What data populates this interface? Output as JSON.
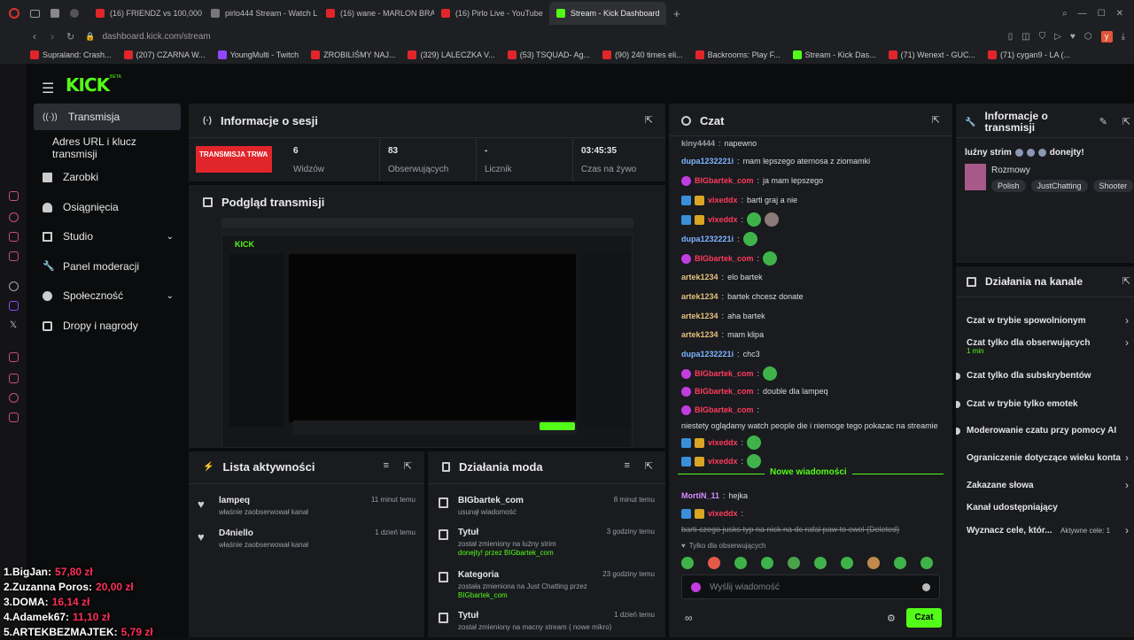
{
  "browser": {
    "tabs": [
      {
        "label": "(16) FRIENDZ vs 100,000 H",
        "icon": "youtube-favicon"
      },
      {
        "label": "pirlo444 Stream - Watch L",
        "icon": "generic-favicon"
      },
      {
        "label": "(16) wane - MARLON BRAN",
        "icon": "youtube-favicon"
      },
      {
        "label": "(16) Pirlo Live - YouTube",
        "icon": "youtube-favicon"
      },
      {
        "label": "Stream - Kick Dashboard",
        "icon": "kick-favicon",
        "active": true
      }
    ],
    "url": "dashboard.kick.com/stream",
    "bookmarks": [
      {
        "label": "Supraland: Crash...",
        "icon": "youtube-favicon"
      },
      {
        "label": "(207) CZARNA W...",
        "icon": "youtube-favicon"
      },
      {
        "label": "YoungMulti - Twitch",
        "icon": "twitch-favicon"
      },
      {
        "label": "ZROBILIŚMY NAJ...",
        "icon": "youtube-favicon"
      },
      {
        "label": "(329) LALECZKA V...",
        "icon": "youtube-favicon"
      },
      {
        "label": "(53) TSQUAD- Ag...",
        "icon": "youtube-favicon"
      },
      {
        "label": "(90) 240 times eli...",
        "icon": "youtube-favicon"
      },
      {
        "label": "Backrooms: Play F...",
        "icon": "youtube-favicon"
      },
      {
        "label": "Stream - Kick Das...",
        "icon": "kick-favicon"
      },
      {
        "label": "(71) Wenext - GUC...",
        "icon": "youtube-favicon"
      },
      {
        "label": "(71) cygan9 - LA (...",
        "icon": "youtube-favicon"
      }
    ],
    "profile_letter": "y"
  },
  "sidebar": {
    "logo": "KICK",
    "logo_sup": "BETA",
    "items": [
      {
        "label": "Transmisja",
        "icon": "broadcast-icon"
      },
      {
        "label": "Adres URL i klucz transmisji",
        "icon": ""
      },
      {
        "label": "Zarobki",
        "icon": "earnings-icon"
      },
      {
        "label": "Osiągnięcia",
        "icon": "trophy-icon"
      },
      {
        "label": "Studio",
        "icon": "studio-icon"
      },
      {
        "label": "Panel moderacji",
        "icon": "wrench-icon"
      },
      {
        "label": "Społeczność",
        "icon": "community-icon"
      },
      {
        "label": "Dropy i nagrody",
        "icon": "gift-icon"
      }
    ]
  },
  "session": {
    "title": "Informacje o sesji",
    "status": "TRANSMISJA TRWA",
    "stats": [
      {
        "value": "6",
        "label": "Widzów"
      },
      {
        "value": "83",
        "label": "Obserwujących"
      },
      {
        "value": "-",
        "label": "Licznik"
      },
      {
        "value": "03:45:35",
        "label": "Czas na żywo"
      }
    ]
  },
  "preview": {
    "title": "Podgląd transmisji"
  },
  "activity": {
    "title": "Lista aktywności",
    "items": [
      {
        "user": "lampeq",
        "desc": "właśnie zaobserwował kanał",
        "time": "11 minut temu"
      },
      {
        "user": "D4niello",
        "desc": "właśnie zaobserwował kanał",
        "time": "1 dzień temu"
      }
    ]
  },
  "modactions": {
    "title": "Działania moda",
    "items": [
      {
        "title": "BIGbartek_com",
        "line1": "usunął wiadomość",
        "line2": "",
        "time": "8 minut temu",
        "icon": "trash-icon"
      },
      {
        "title": "Tytuł",
        "line1": "został zmieniony na luźny strim",
        "line2": "donejty! przez BIGbartek_com",
        "time": "3 godziny temu",
        "icon": "user-edit-icon"
      },
      {
        "title": "Kategoria",
        "line1": "została zmieniona na Just Chatting przez",
        "line2": "BIGbartek_com",
        "time": "23 godziny temu",
        "icon": "category-icon"
      },
      {
        "title": "Tytuł",
        "line1": "został zmieniony na macny stream ( nowe mikro)",
        "line2": "",
        "time": "1 dzień temu",
        "icon": "user-edit-icon"
      }
    ]
  },
  "chat": {
    "title": "Czat",
    "messages": [
      {
        "user": "kiny4444",
        "text": "napewno",
        "color": "#9aa0a6",
        "badges": []
      },
      {
        "user": "dupa1232221i",
        "text": "mam lepszego aternosa z ziomamki",
        "color": "#7fb3ff",
        "badges": []
      },
      {
        "user": "BIGbartek_com",
        "text": "ja mam lepszego",
        "color": "#ff3b5c",
        "badges": [
          "mic"
        ]
      },
      {
        "user": "vixeddx",
        "text": "barti graj a nie",
        "color": "#ff3b5c",
        "badges": [
          "blue",
          "gold"
        ]
      },
      {
        "user": "vixeddx",
        "text": "",
        "color": "#ff3b5c",
        "badges": [
          "blue",
          "gold"
        ],
        "emotes": 2
      },
      {
        "user": "dupa1232221i",
        "text": "",
        "color": "#7fb3ff",
        "badges": [],
        "emotes": 1
      },
      {
        "user": "BIGbartek_com",
        "text": "",
        "color": "#ff3b5c",
        "badges": [
          "mic"
        ],
        "emotes": 1
      },
      {
        "user": "artek1234",
        "text": "elo bartek",
        "color": "#e7c07a",
        "badges": []
      },
      {
        "user": "artek1234",
        "text": "bartek chcesz donate",
        "color": "#e7c07a",
        "badges": []
      },
      {
        "user": "artek1234",
        "text": "aha bartek",
        "color": "#e7c07a",
        "badges": []
      },
      {
        "user": "artek1234",
        "text": "mam klipa",
        "color": "#e7c07a",
        "badges": []
      },
      {
        "user": "dupa1232221i",
        "text": "chc3",
        "color": "#7fb3ff",
        "badges": []
      },
      {
        "user": "BIGbartek_com",
        "text": "",
        "color": "#ff3b5c",
        "badges": [
          "mic"
        ],
        "emotes": 1
      },
      {
        "user": "BIGbartek_com",
        "text": "double dla lampeq",
        "color": "#ff3b5c",
        "badges": [
          "mic"
        ]
      },
      {
        "user": "BIGbartek_com",
        "text": "niestety oglądamy watch people die i niemoge tego pokazac na streamie",
        "color": "#ff3b5c",
        "badges": [
          "mic"
        ]
      },
      {
        "user": "vixeddx",
        "text": "",
        "color": "#ff3b5c",
        "badges": [
          "blue",
          "gold"
        ],
        "emotes": 1
      },
      {
        "user": "vixeddx",
        "text": "",
        "color": "#ff3b5c",
        "badges": [
          "blue",
          "gold"
        ],
        "emotes": 1
      }
    ],
    "new_messages": "Nowe wiadomości",
    "after": [
      {
        "user": "MortiN_11",
        "text": "hejka",
        "color": "#d88cff",
        "badges": []
      },
      {
        "user": "vixeddx",
        "text": "barti czego jusks typ na nick na dc rafal paw to cwel (Deleted)",
        "color": "#ff3b5c",
        "badges": [
          "blue",
          "gold"
        ],
        "deleted": true
      }
    ],
    "followers_only": "Tylko dla obserwujących",
    "input_placeholder": "Wyślij wiadomość",
    "send_label": "Czat"
  },
  "streaminfo": {
    "title": "Informacje o transmisji",
    "stream_title": "luźny strim",
    "stream_title_suffix": "donejty!",
    "category": "Rozmowy",
    "tags": [
      "Polish",
      "JustChatting",
      "Shooter"
    ]
  },
  "channel": {
    "title": "Działania na kanale",
    "actions": [
      {
        "label": "Czat w trybie spowolnionym",
        "control": "chevron"
      },
      {
        "label": "Czat tylko dla obserwujących",
        "sub": "1 min",
        "control": "chevron"
      },
      {
        "label": "Czat tylko dla subskrybentów",
        "control": "toggle"
      },
      {
        "label": "Czat w trybie tylko emotek",
        "control": "toggle"
      },
      {
        "label": "Moderowanie czatu przy pomocy AI",
        "control": "toggle"
      },
      {
        "label": "Ograniczenie dotyczące wieku konta",
        "control": "chevron"
      },
      {
        "label": "Zakazane słowa",
        "control": "chevron"
      },
      {
        "label": "Kanał udostępniający",
        "control": "none"
      },
      {
        "label": "Wyznacz cele, któr...",
        "sub": "Aktywne cele: 1",
        "control": "chevron"
      }
    ]
  },
  "donors": [
    {
      "name": "1.BigJan:",
      "amount": "57,80 zł"
    },
    {
      "name": "2.Zuzanna Poros:",
      "amount": "20,00 zł"
    },
    {
      "name": "3.DOMA:",
      "amount": "16,14 zł"
    },
    {
      "name": "4.Adamek67:",
      "amount": "11,10 zł"
    },
    {
      "name": "5.ARTEKBEZMAJTEK:",
      "amount": "5,79 zł"
    }
  ]
}
